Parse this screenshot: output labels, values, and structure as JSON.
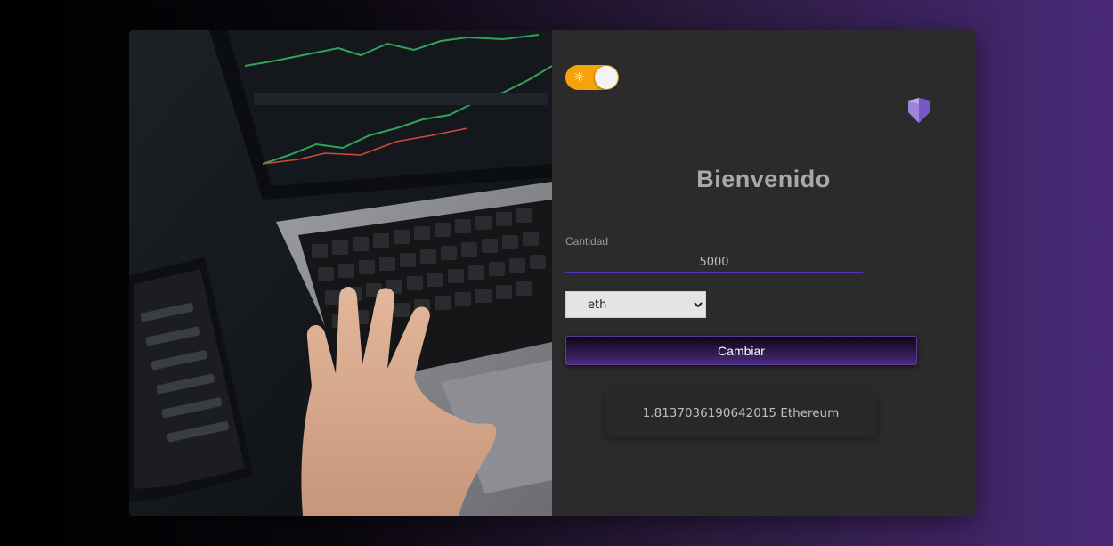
{
  "theme_toggle": {
    "icon": "sun-icon",
    "state": "on"
  },
  "logo": {
    "icon": "shield-logo-icon"
  },
  "title": "Bienvenido",
  "amount_field": {
    "label": "Cantidad",
    "value": "5000"
  },
  "currency_select": {
    "selected": "eth",
    "options": [
      "eth"
    ]
  },
  "convert_button": {
    "label": "Cambiar"
  },
  "result": {
    "text": "1.8137036190642015 Ethereum"
  },
  "colors": {
    "accent": "#5b2fc4",
    "toggle": "#f5a30a",
    "panel": "#2b2b2b"
  }
}
